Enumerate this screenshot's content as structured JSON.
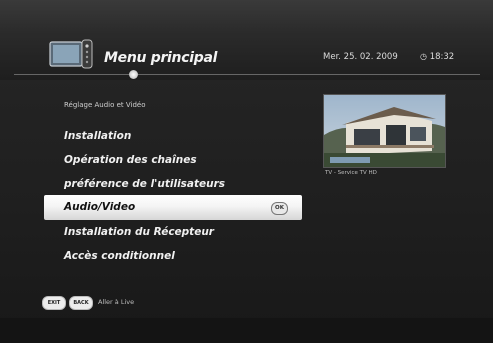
{
  "header": {
    "title": "Menu principal",
    "date": "Mer. 25. 02. 2009",
    "time": "18:32",
    "clock_icon": "clock-icon",
    "logo_icon": "tv-remote-icon"
  },
  "section_title": "Réglage Audio et Vidéo",
  "menu": {
    "items": [
      {
        "label": "Installation"
      },
      {
        "label": "Opération des chaînes"
      },
      {
        "label": "préférence de l'utilisateurs"
      },
      {
        "label": "Audio/Video",
        "selected": true,
        "ok_label": "OK"
      },
      {
        "label": "Installation du Récepteur"
      },
      {
        "label": "Accès conditionnel"
      }
    ]
  },
  "preview": {
    "caption": "TV - Service TV HD"
  },
  "footer": {
    "exit_label": "EXIT",
    "back_label": "BACK",
    "hint": "Aller à Live"
  },
  "colors": {
    "background": "#1f1f1f",
    "highlight": "#f4f4f4",
    "text": "#f0f0f0"
  }
}
